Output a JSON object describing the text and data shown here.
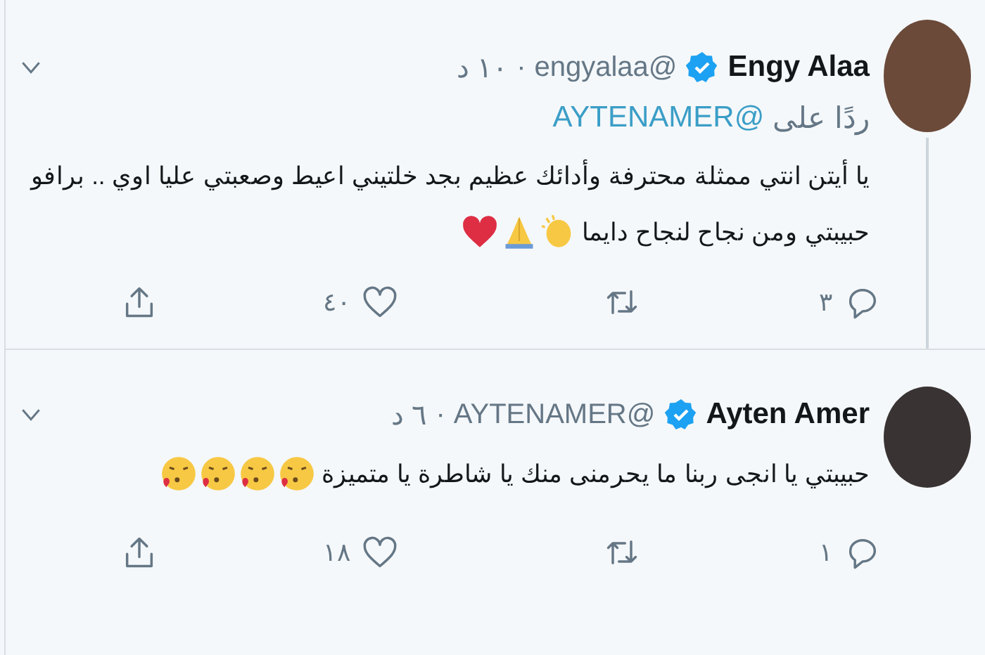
{
  "tweets": [
    {
      "name": "Engy Alaa",
      "verified": true,
      "handle": "@engyalaa",
      "separator": "·",
      "time": "١٠ د",
      "reply_to": {
        "prefix": "ردًا على",
        "handle": "@AYTENAMER"
      },
      "text_lines": [
        "يا أيتن انتي ممثلة محترفة وأدائك عظيم بجد خلتيني اعيط وصعبتي عليا اوي .. برافو",
        "حبيبتي ومن نجاح لنجاح دايما"
      ],
      "emojis": [
        {
          "kind": "clap"
        },
        {
          "kind": "pray"
        },
        {
          "kind": "heart"
        }
      ],
      "thread_line": true,
      "actions": [
        {
          "kind": "reply",
          "count": "٣"
        },
        {
          "kind": "retweet"
        },
        {
          "kind": "like",
          "count": "٤٠"
        },
        {
          "kind": "share"
        }
      ]
    },
    {
      "name": "Ayten Amer",
      "verified": true,
      "handle": "@AYTENAMER",
      "separator": "·",
      "time": "٦ د",
      "text_lines": [
        "حبيبتي يا انجى ربنا ما يحرمنى منك يا شاطرة يا متميزة"
      ],
      "emojis": [
        {
          "kind": "kiss"
        },
        {
          "kind": "kiss"
        },
        {
          "kind": "kiss"
        },
        {
          "kind": "kiss"
        }
      ],
      "thread_line": false,
      "actions": [
        {
          "kind": "reply",
          "count": "١"
        },
        {
          "kind": "retweet"
        },
        {
          "kind": "like",
          "count": "١٨"
        },
        {
          "kind": "share"
        }
      ]
    }
  ]
}
